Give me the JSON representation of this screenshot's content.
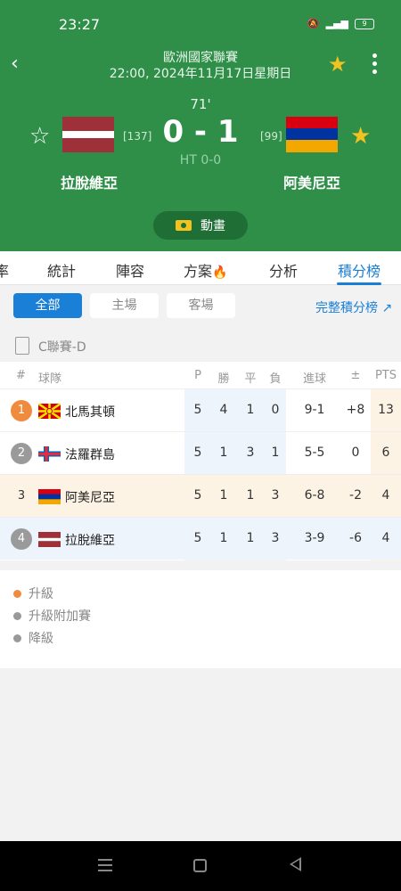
{
  "status": {
    "time": "23:27",
    "battery": "9"
  },
  "match": {
    "league": "歐洲國家聯賽",
    "datetime": "22:00, 2024年11月17日星期日",
    "minute": "71'",
    "score": "0 - 1",
    "halftime": "HT 0-0",
    "home": {
      "name": "拉脫維亞",
      "rank": "[137]"
    },
    "away": {
      "name": "阿美尼亞",
      "rank": "[99]"
    },
    "animation_label": "動畫"
  },
  "tabs": [
    "率",
    "統計",
    "陣容",
    "方案",
    "分析",
    "積分榜"
  ],
  "filters": {
    "all": "全部",
    "home": "主場",
    "away": "客場",
    "full_link": "完整積分榜"
  },
  "group": "C聯賽-D",
  "table": {
    "headers": {
      "pos": "#",
      "team": "球隊",
      "p": "P",
      "w": "勝",
      "d": "平",
      "l": "負",
      "goals": "進球",
      "diff": "±",
      "pts": "PTS"
    },
    "rows": [
      {
        "pos": "1",
        "team": "北馬其頓",
        "p": "5",
        "w": "4",
        "d": "1",
        "l": "0",
        "goals": "9-1",
        "diff": "+8",
        "pts": "13"
      },
      {
        "pos": "2",
        "team": "法羅群島",
        "p": "5",
        "w": "1",
        "d": "3",
        "l": "1",
        "goals": "5-5",
        "diff": "0",
        "pts": "6"
      },
      {
        "pos": "3",
        "team": "阿美尼亞",
        "p": "5",
        "w": "1",
        "d": "1",
        "l": "3",
        "goals": "6-8",
        "diff": "-2",
        "pts": "4"
      },
      {
        "pos": "4",
        "team": "拉脫維亞",
        "p": "5",
        "w": "1",
        "d": "1",
        "l": "3",
        "goals": "3-9",
        "diff": "-6",
        "pts": "4"
      }
    ]
  },
  "legend": [
    "升級",
    "升級附加賽",
    "降級"
  ],
  "colors": {
    "header_green": "#2f8f48",
    "accent_blue": "#1a7fd6",
    "promote": "#f08a3c",
    "neutral": "#999999",
    "star": "#f4c21f"
  }
}
